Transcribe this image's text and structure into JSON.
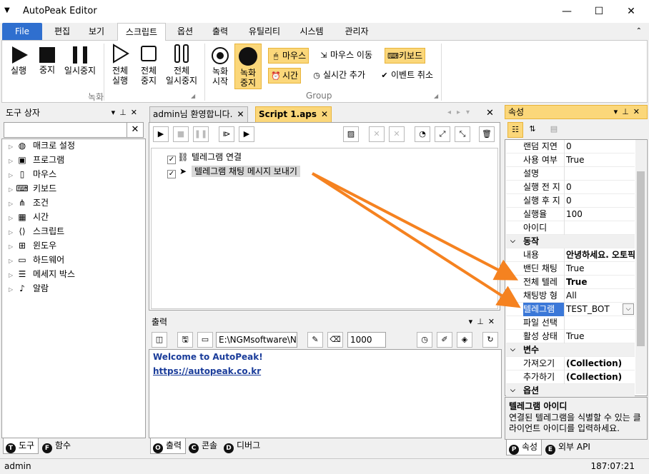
{
  "window": {
    "title": "AutoPeak Editor",
    "minimize": "—",
    "maximize": "☐",
    "close": "✕"
  },
  "menu": {
    "file": "File",
    "tabs": [
      "편집",
      "보기",
      "스크립트",
      "옵션",
      "출력",
      "유틸리티",
      "시스템",
      "관리자"
    ],
    "active_tab": "스크립트"
  },
  "ribbon": {
    "run": "실행",
    "stop": "중지",
    "pause": "일시중지",
    "run_all": [
      "전체",
      "실행"
    ],
    "stop_all": [
      "전체",
      "중지"
    ],
    "pause_all": [
      "전체",
      "일시중지"
    ],
    "rec_start": [
      "녹화",
      "시작"
    ],
    "rec_stop": [
      "녹화",
      "중지"
    ],
    "group_record": "녹화",
    "group_group": "Group",
    "mouse": "마우스",
    "mouse_move": "마우스 이동",
    "keyboard": "키보드",
    "time": "시간",
    "realtime_add": "실시간 추가",
    "event_cancel": "이벤트 취소"
  },
  "toolbox": {
    "title": "도구 상자",
    "search_placeholder": "",
    "items": [
      {
        "label": "매크로 설정",
        "icon": "globe-icon"
      },
      {
        "label": "프로그램",
        "icon": "program-icon"
      },
      {
        "label": "마우스",
        "icon": "mouse-icon"
      },
      {
        "label": "키보드",
        "icon": "keyboard-icon"
      },
      {
        "label": "조건",
        "icon": "condition-icon"
      },
      {
        "label": "시간",
        "icon": "calendar-icon"
      },
      {
        "label": "스크립트",
        "icon": "script-icon"
      },
      {
        "label": "윈도우",
        "icon": "windows-icon"
      },
      {
        "label": "하드웨어",
        "icon": "laptop-icon"
      },
      {
        "label": "메세지 박스",
        "icon": "message-icon"
      },
      {
        "label": "알람",
        "icon": "bell-icon"
      }
    ],
    "tabs": [
      {
        "badge": "T",
        "label": "도구"
      },
      {
        "badge": "F",
        "label": "함수"
      }
    ]
  },
  "documents": {
    "tabs": [
      "admin님 환영합니다.",
      "Script 1.aps"
    ],
    "active": "Script 1.aps",
    "lines": [
      {
        "label": "텔레그램 연결",
        "checked": true,
        "icon": "link-icon"
      },
      {
        "label": "텔레그램 채팅 메시지 보내기",
        "checked": true,
        "icon": "telegram-icon",
        "selected": true
      }
    ]
  },
  "output": {
    "title": "출력",
    "path": "E:\\NGMsoftware\\NG",
    "count": "1000",
    "lines": [
      "Welcome to AutoPeak!"
    ],
    "link": "https://autopeak.co.kr",
    "tabs": [
      {
        "badge": "O",
        "label": "출력"
      },
      {
        "badge": "C",
        "label": "콘솔"
      },
      {
        "badge": "D",
        "label": "디버그"
      }
    ]
  },
  "properties": {
    "title": "속성",
    "rows": [
      {
        "type": "prop",
        "name": "랜덤 지연",
        "value": "0"
      },
      {
        "type": "prop",
        "name": "사용 여부",
        "value": "True"
      },
      {
        "type": "prop",
        "name": "설명",
        "value": ""
      },
      {
        "type": "prop",
        "name": "실행 전 지",
        "value": "0"
      },
      {
        "type": "prop",
        "name": "실행 후 지",
        "value": "0"
      },
      {
        "type": "prop",
        "name": "실행율",
        "value": "100"
      },
      {
        "type": "prop",
        "name": "아이디",
        "value": ""
      },
      {
        "type": "cat",
        "name": "동작"
      },
      {
        "type": "prop",
        "name": "내용",
        "value": "안녕하세요. 오토픽",
        "bold": true
      },
      {
        "type": "prop",
        "name": "밴딘 채팅",
        "value": "True"
      },
      {
        "type": "prop",
        "name": "전체 텔레",
        "value": "True",
        "bold": true
      },
      {
        "type": "prop",
        "name": "채팅방 형",
        "value": "All"
      },
      {
        "type": "prop",
        "name": "텔레그램",
        "value": "TEST_BOT",
        "selected": true,
        "dropdown": true
      },
      {
        "type": "prop",
        "name": "파일 선택",
        "value": ""
      },
      {
        "type": "prop",
        "name": "활성 상태",
        "value": "True"
      },
      {
        "type": "cat",
        "name": "변수"
      },
      {
        "type": "prop",
        "name": "가져오기",
        "value": "(Collection)",
        "bold": true
      },
      {
        "type": "prop",
        "name": "추가하기",
        "value": "(Collection)",
        "bold": true
      },
      {
        "type": "cat",
        "name": "옵션"
      }
    ],
    "desc_title": "텔레그램 아이디",
    "desc_text": "연결된 텔레그램을 식별할 수 있는 클라이언트 아이디를 입력하세요.",
    "tabs": [
      {
        "badge": "P",
        "label": "속성"
      },
      {
        "badge": "E",
        "label": "외부 API"
      }
    ]
  },
  "status": {
    "user": "admin",
    "time": "187:07:21"
  },
  "colors": {
    "accent": "#fbd77a",
    "file_tab": "#2f6fcf",
    "arrow": "#f58220",
    "selection": "#3b78d8"
  }
}
